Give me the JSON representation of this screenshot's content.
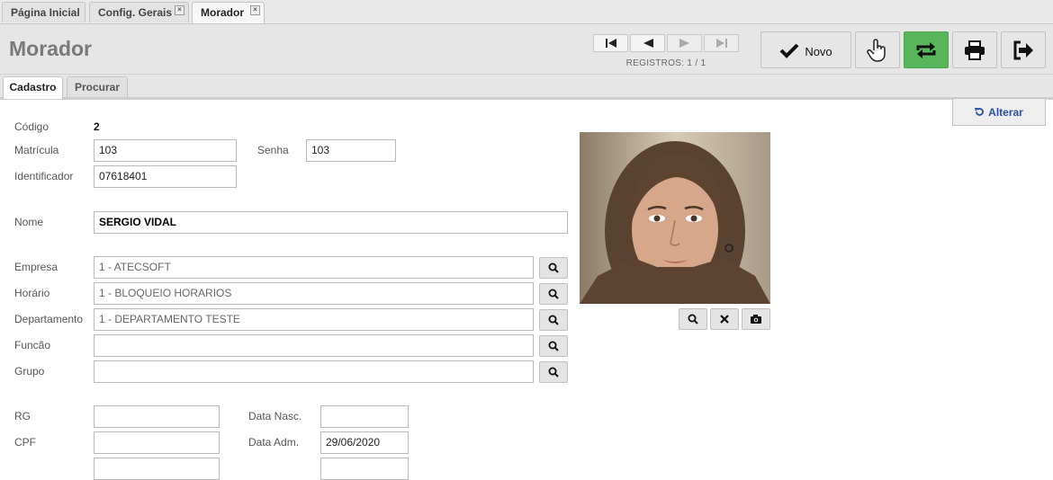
{
  "tabs": [
    {
      "label": "Página Inicial",
      "closable": false
    },
    {
      "label": "Config. Gerais",
      "closable": true
    },
    {
      "label": "Morador",
      "closable": true,
      "active": true
    }
  ],
  "header": {
    "title": "Morador",
    "registros": "REGISTROS: 1 / 1",
    "novo_label": "Novo"
  },
  "subtabs": [
    "Cadastro",
    "Procurar"
  ],
  "alterar_label": "Alterar",
  "form": {
    "codigo_label": "Código",
    "codigo_value": "2",
    "matricula_label": "Matrícula",
    "matricula_value": "103",
    "senha_label": "Senha",
    "senha_value": "103",
    "identificador_label": "Identificador",
    "identificador_value": "07618401",
    "nome_label": "Nome",
    "nome_value": "SERGIO VIDAL",
    "empresa_label": "Empresa",
    "empresa_value": "1 - ATECSOFT",
    "horario_label": "Horário",
    "horario_value": "1 - BLOQUEIO HORARIOS",
    "departamento_label": "Departamento",
    "departamento_value": "1 - DEPARTAMENTO TESTE",
    "funcao_label": "Funcão",
    "funcao_value": "",
    "grupo_label": "Grupo",
    "grupo_value": "",
    "rg_label": "RG",
    "rg_value": "",
    "cpf_label": "CPF",
    "cpf_value": "",
    "data_nasc_label": "Data Nasc.",
    "data_nasc_value": "",
    "data_adm_label": "Data Adm.",
    "data_adm_value": "29/06/2020"
  },
  "colors": {
    "accent_green": "#57b65a",
    "link_blue": "#2a4fa8"
  },
  "icons": {
    "nav": [
      "first-record-icon",
      "previous-record-icon",
      "next-record-icon",
      "last-record-icon"
    ],
    "toolbar": [
      "checkmark-icon",
      "hand-pointer-icon",
      "refresh-icon",
      "print-icon",
      "exit-icon"
    ],
    "photo": [
      "search-icon",
      "close-icon",
      "camera-icon"
    ]
  }
}
